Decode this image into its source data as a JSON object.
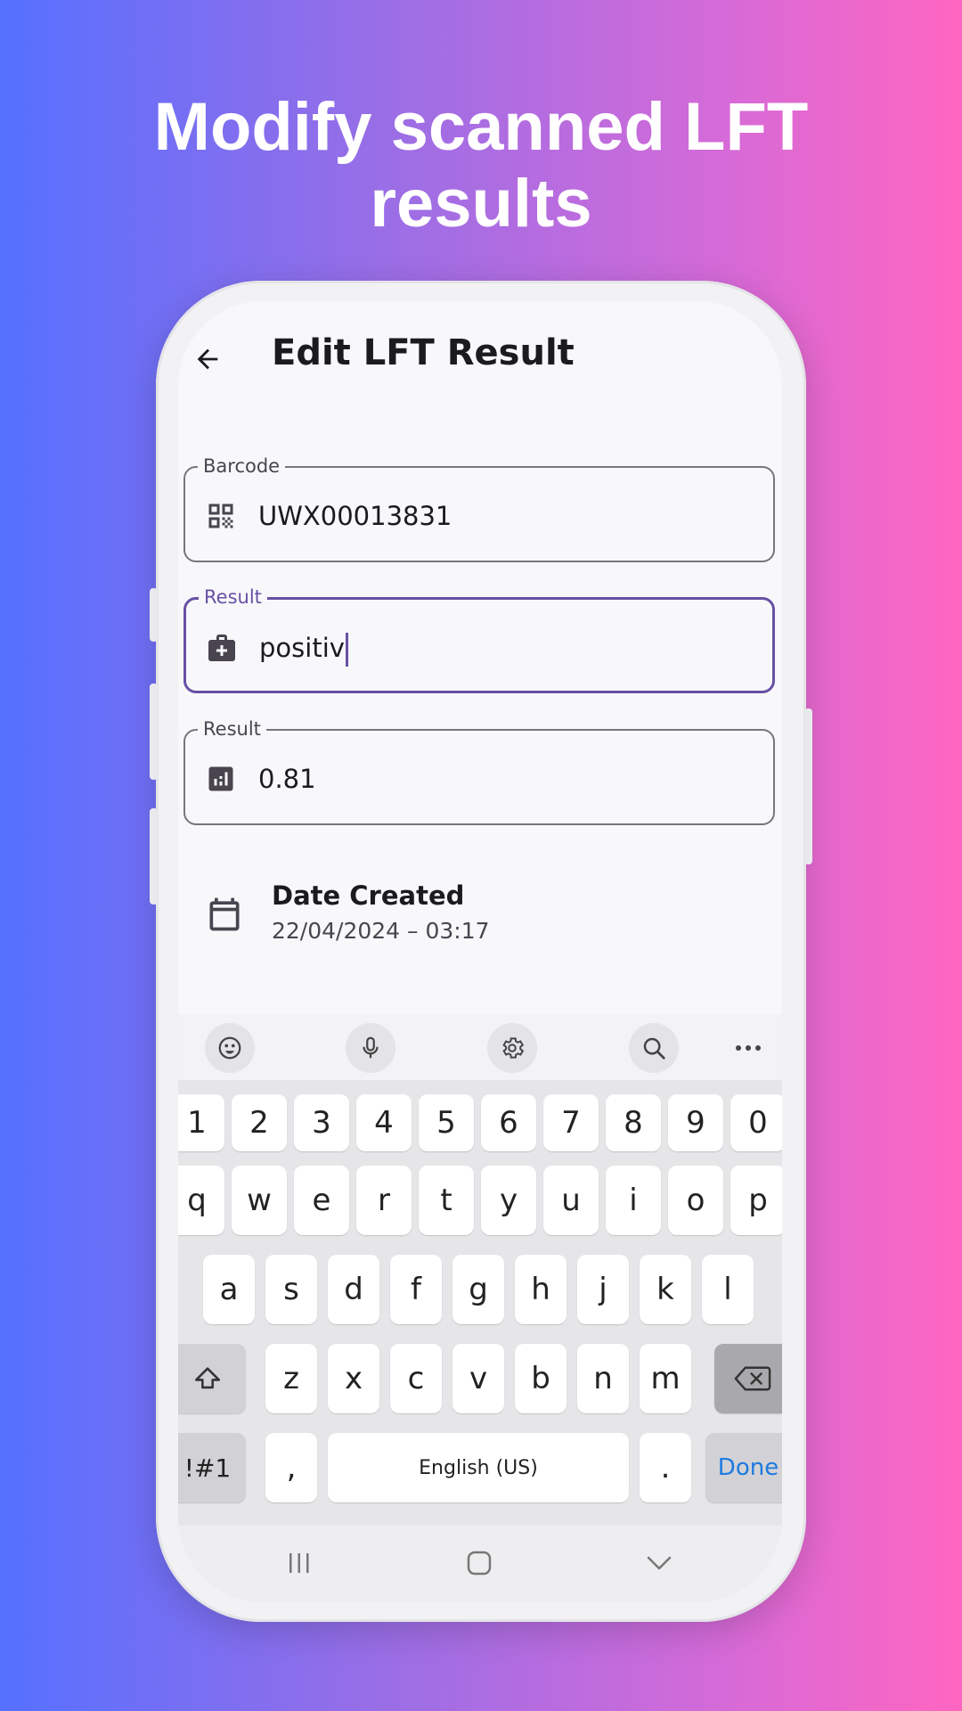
{
  "headline": {
    "line1": "Modify scanned LFT",
    "line2": "results"
  },
  "app_bar": {
    "title": "Edit LFT Result",
    "back_icon": "arrow-left-icon"
  },
  "form": {
    "barcode": {
      "label": "Barcode",
      "value": "UWX00013831",
      "icon": "qr-code-icon"
    },
    "result_text": {
      "label": "Result",
      "value": "positiv",
      "icon": "medical-bag-icon",
      "focused": true
    },
    "result_score": {
      "label": "Result",
      "value": "0.81",
      "icon": "bar-chart-icon"
    },
    "date_created": {
      "label": "Date Created",
      "value": "22/04/2024 – 03:17",
      "icon": "calendar-icon"
    }
  },
  "keyboard": {
    "toolbar": [
      "emoji-icon",
      "microphone-icon",
      "settings-icon",
      "search-icon",
      "more-icon"
    ],
    "number_row": [
      "1",
      "2",
      "3",
      "4",
      "5",
      "6",
      "7",
      "8",
      "9",
      "0"
    ],
    "row1": [
      "q",
      "w",
      "e",
      "r",
      "t",
      "y",
      "u",
      "i",
      "o",
      "p"
    ],
    "row2": [
      "a",
      "s",
      "d",
      "f",
      "g",
      "h",
      "j",
      "k",
      "l"
    ],
    "row3": [
      "z",
      "x",
      "c",
      "v",
      "b",
      "n",
      "m"
    ],
    "symbols_key": "!#1",
    "comma_key": ",",
    "space_key": "English (US)",
    "period_key": ".",
    "done_key": "Done"
  },
  "nav": [
    "recents-icon",
    "home-icon",
    "back-chevron-icon"
  ],
  "colors": {
    "accent": "#6750a4",
    "done": "#1f7ae0"
  }
}
